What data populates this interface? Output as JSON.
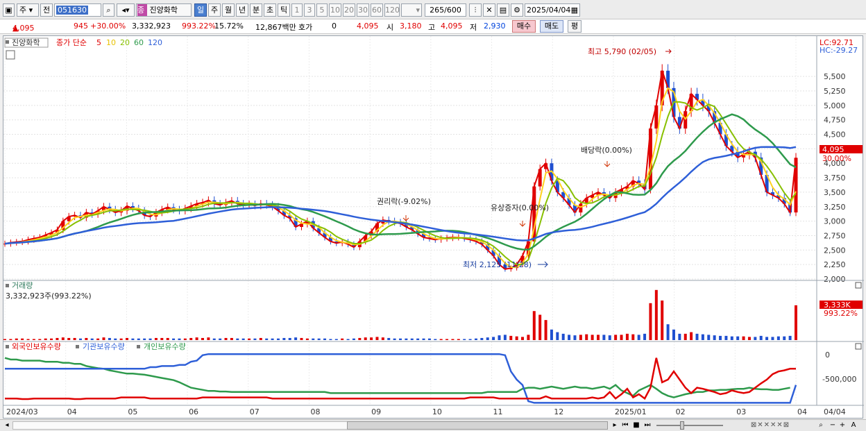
{
  "toolbar": {
    "stock_type": "주",
    "prev_label": "전",
    "code": "051630",
    "stock_name": "진양화학",
    "badge": "종",
    "periods": [
      "일",
      "주",
      "월",
      "년",
      "분",
      "초",
      "틱"
    ],
    "active_period": "일",
    "intervals": [
      "1",
      "3",
      "5",
      "10",
      "20",
      "30",
      "60",
      "120"
    ],
    "count": "265",
    "count_total": "/600",
    "date": "2025/04/04"
  },
  "quote": {
    "price": "4,095",
    "change": "945",
    "change_pct": "+30.00%",
    "volume": "3,332,923",
    "volume_ratio": "993.22%",
    "turnover_pct": "15.72%",
    "trade_value": "12,867백만",
    "hoga_label": "호가",
    "hoga_value": "0",
    "hoga_price": "4,095",
    "open_label": "시",
    "open": "3,180",
    "high_label": "고",
    "high": "4,095",
    "low_label": "저",
    "low": "2,930",
    "buy_label": "매수",
    "sell_label": "매도",
    "avg_label": "평"
  },
  "price_panel": {
    "name_tag": "진양화학",
    "ma_label": "종가 단순",
    "ma_periods": [
      "5",
      "10",
      "20",
      "60",
      "120"
    ],
    "ma_colors": [
      "#e00000",
      "#ffd21f",
      "#88c000",
      "#2e9a4c",
      "#2e5fd8"
    ],
    "lc": "LC:92.71",
    "hc": "HC:-29.27",
    "last_price": "4,095",
    "last_pct": "30.00%",
    "annotations": {
      "high": "최고 5,790 (02/05)",
      "low": "최저 2,125 (11/28)",
      "rights": "권리락(-9.02%)",
      "capital": "유상증자(0.00%)",
      "dividend": "배당락(0.00%)"
    },
    "y_ticks": [
      "5,500",
      "5,250",
      "5,000",
      "4,750",
      "4,500",
      "4,250",
      "4,000",
      "3,750",
      "3,500",
      "3,250",
      "3,000",
      "2,750",
      "2,500",
      "2,250",
      "2,000"
    ]
  },
  "volume_panel": {
    "title": "거래량",
    "subtitle": "3,332,923주(993.22%)",
    "last_value": "3,333K",
    "last_pct": "993.22%"
  },
  "holdings_panel": {
    "series": [
      "외국인보유수량",
      "기관보유수량",
      "개인보유수량"
    ],
    "series_colors": [
      "#e00000",
      "#2e5fd8",
      "#2e9a4c"
    ],
    "y_ticks": [
      "0",
      "-500,000"
    ]
  },
  "x_axis": {
    "labels": [
      "2024/03",
      "04",
      "05",
      "06",
      "07",
      "08",
      "09",
      "10",
      "11",
      "12",
      "2025/01",
      "02",
      "03",
      "04"
    ],
    "current": "04/04"
  },
  "chart_data": {
    "type": "candlestick",
    "ylim": [
      2000,
      5790
    ],
    "close": [
      2610,
      2630,
      2640,
      2650,
      2680,
      2700,
      2720,
      2760,
      2800,
      2850,
      3000,
      3080,
      3100,
      3060,
      3150,
      3120,
      3180,
      3250,
      3200,
      3150,
      3180,
      3260,
      3220,
      3180,
      3100,
      3080,
      3150,
      3200,
      3240,
      3200,
      3180,
      3220,
      3260,
      3300,
      3320,
      3360,
      3300,
      3280,
      3320,
      3350,
      3300,
      3280,
      3290,
      3270,
      3300,
      3280,
      3250,
      3180,
      3100,
      3050,
      2900,
      2950,
      3000,
      2880,
      2800,
      2720,
      2650,
      2620,
      2640,
      2600,
      2550,
      2650,
      2750,
      2820,
      2960,
      3020,
      3000,
      2980,
      2960,
      2900,
      2850,
      2780,
      2720,
      2700,
      2680,
      2700,
      2710,
      2720,
      2720,
      2700,
      2680,
      2650,
      2600,
      2500,
      2400,
      2250,
      2170,
      2190,
      2250,
      2400,
      2650,
      3600,
      3900,
      4000,
      3700,
      3500,
      3400,
      3280,
      3150,
      3300,
      3400,
      3450,
      3500,
      3450,
      3400,
      3500,
      3550,
      3600,
      3700,
      3650,
      3550,
      4600,
      5000,
      5600,
      5300,
      4800,
      4600,
      4900,
      5200,
      5100,
      5000,
      4900,
      4700,
      4500,
      4300,
      4200,
      4100,
      4150,
      4200,
      4100,
      3800,
      3500,
      3450,
      3400,
      3300,
      3150,
      4095
    ],
    "volume": [
      0.02,
      0.02,
      0.03,
      0.03,
      0.02,
      0.02,
      0.02,
      0.03,
      0.03,
      0.04,
      0.05,
      0.04,
      0.04,
      0.03,
      0.04,
      0.03,
      0.03,
      0.05,
      0.04,
      0.03,
      0.03,
      0.04,
      0.03,
      0.03,
      0.03,
      0.03,
      0.04,
      0.04,
      0.04,
      0.03,
      0.03,
      0.03,
      0.04,
      0.05,
      0.04,
      0.05,
      0.03,
      0.03,
      0.04,
      0.04,
      0.03,
      0.03,
      0.03,
      0.03,
      0.04,
      0.03,
      0.03,
      0.03,
      0.04,
      0.04,
      0.05,
      0.04,
      0.03,
      0.03,
      0.03,
      0.03,
      0.02,
      0.02,
      0.03,
      0.02,
      0.03,
      0.04,
      0.05,
      0.05,
      0.06,
      0.05,
      0.04,
      0.03,
      0.03,
      0.03,
      0.03,
      0.03,
      0.03,
      0.03,
      0.02,
      0.02,
      0.02,
      0.02,
      0.02,
      0.02,
      0.02,
      0.03,
      0.04,
      0.05,
      0.06,
      0.09,
      0.1,
      0.08,
      0.07,
      0.06,
      0.1,
      0.55,
      0.48,
      0.38,
      0.2,
      0.15,
      0.12,
      0.1,
      0.09,
      0.1,
      0.11,
      0.1,
      0.1,
      0.1,
      0.09,
      0.1,
      0.1,
      0.12,
      0.11,
      0.1,
      0.12,
      0.7,
      0.95,
      0.75,
      0.3,
      0.2,
      0.12,
      0.12,
      0.15,
      0.12,
      0.11,
      0.1,
      0.09,
      0.08,
      0.08,
      0.07,
      0.07,
      0.07,
      0.06,
      0.06,
      0.08,
      0.06,
      0.06,
      0.07,
      0.07,
      0.08,
      0.66
    ],
    "foreign": [
      0.1,
      0.1,
      0.1,
      0.09,
      0.09,
      0.1,
      0.1,
      0.1,
      0.1,
      0.1,
      0.1,
      0.1,
      0.09,
      0.09,
      0.1,
      0.1,
      0.1,
      0.1,
      0.1,
      0.1,
      0.12,
      0.12,
      0.12,
      0.12,
      0.12,
      0.1,
      0.1,
      0.1,
      0.1,
      0.1,
      0.1,
      0.1,
      0.1,
      0.1,
      0.12,
      0.12,
      0.12,
      0.12,
      0.12,
      0.12,
      0.12,
      0.12,
      0.12,
      0.12,
      0.12,
      0.12,
      0.1,
      0.1,
      0.1,
      0.1,
      0.1,
      0.1,
      0.1,
      0.1,
      0.1,
      0.1,
      0.1,
      0.1,
      0.1,
      0.1,
      0.1,
      0.1,
      0.1,
      0.1,
      0.1,
      0.1,
      0.1,
      0.1,
      0.1,
      0.1,
      0.1,
      0.1,
      0.1,
      0.1,
      0.1,
      0.1,
      0.1,
      0.1,
      0.1,
      0.1,
      0.12,
      0.12,
      0.12,
      0.12,
      0.12,
      0.1,
      0.1,
      0.1,
      0.1,
      0.1,
      0.1,
      0.1,
      0.1,
      0.14,
      0.1,
      0.1,
      0.1,
      0.1,
      0.1,
      0.1,
      0.1,
      0.12,
      0.1,
      0.12,
      0.22,
      0.1,
      0.18,
      0.28,
      0.12,
      0.18,
      0.1,
      0.3,
      0.85,
      0.4,
      0.45,
      0.6,
      0.45,
      0.3,
      0.2,
      0.3,
      0.28,
      0.25,
      0.22,
      0.18,
      0.2,
      0.25,
      0.22,
      0.2,
      0.22,
      0.3,
      0.38,
      0.45,
      0.55,
      0.6,
      0.62,
      0.65,
      0.65
    ],
    "institution": [
      0.65,
      0.65,
      0.65,
      0.65,
      0.65,
      0.65,
      0.65,
      0.65,
      0.65,
      0.65,
      0.65,
      0.65,
      0.65,
      0.65,
      0.65,
      0.65,
      0.65,
      0.65,
      0.65,
      0.65,
      0.65,
      0.65,
      0.65,
      0.65,
      0.65,
      0.68,
      0.68,
      0.7,
      0.7,
      0.7,
      0.72,
      0.72,
      0.78,
      0.8,
      0.9,
      0.92,
      0.92,
      0.92,
      0.92,
      0.92,
      0.92,
      0.92,
      0.92,
      0.92,
      0.92,
      0.92,
      0.92,
      0.92,
      0.92,
      0.92,
      0.92,
      0.92,
      0.92,
      0.92,
      0.92,
      0.92,
      0.92,
      0.92,
      0.92,
      0.92,
      0.92,
      0.92,
      0.92,
      0.92,
      0.92,
      0.92,
      0.92,
      0.92,
      0.92,
      0.92,
      0.92,
      0.92,
      0.92,
      0.92,
      0.92,
      0.92,
      0.92,
      0.92,
      0.92,
      0.92,
      0.92,
      0.92,
      0.92,
      0.92,
      0.92,
      0.92,
      0.9,
      0.6,
      0.45,
      0.35,
      0.05,
      0.02,
      0.02,
      0.02,
      0.02,
      0.02,
      0.02,
      0.02,
      0.02,
      0.02,
      0.02,
      0.02,
      0.02,
      0.02,
      0.02,
      0.02,
      0.02,
      0.02,
      0.02,
      0.02,
      0.02,
      0.02,
      0.02,
      0.02,
      0.02,
      0.02,
      0.02,
      0.02,
      0.02,
      0.02,
      0.02,
      0.02,
      0.02,
      0.02,
      0.02,
      0.02,
      0.02,
      0.02,
      0.02,
      0.02,
      0.02,
      0.02,
      0.02,
      0.02,
      0.02,
      0.02,
      0.35
    ],
    "individual": [
      0.85,
      0.82,
      0.82,
      0.8,
      0.8,
      0.8,
      0.8,
      0.78,
      0.78,
      0.78,
      0.76,
      0.76,
      0.74,
      0.74,
      0.7,
      0.68,
      0.66,
      0.65,
      0.62,
      0.6,
      0.58,
      0.56,
      0.56,
      0.55,
      0.54,
      0.52,
      0.5,
      0.48,
      0.46,
      0.44,
      0.4,
      0.35,
      0.3,
      0.28,
      0.26,
      0.24,
      0.24,
      0.23,
      0.23,
      0.22,
      0.22,
      0.22,
      0.22,
      0.22,
      0.22,
      0.22,
      0.22,
      0.22,
      0.22,
      0.22,
      0.22,
      0.22,
      0.22,
      0.22,
      0.22,
      0.22,
      0.2,
      0.2,
      0.2,
      0.2,
      0.2,
      0.2,
      0.2,
      0.2,
      0.2,
      0.2,
      0.2,
      0.2,
      0.2,
      0.2,
      0.2,
      0.2,
      0.2,
      0.2,
      0.2,
      0.2,
      0.2,
      0.2,
      0.2,
      0.2,
      0.2,
      0.2,
      0.2,
      0.22,
      0.22,
      0.22,
      0.22,
      0.22,
      0.22,
      0.28,
      0.3,
      0.3,
      0.28,
      0.3,
      0.32,
      0.3,
      0.28,
      0.3,
      0.32,
      0.3,
      0.3,
      0.28,
      0.3,
      0.32,
      0.28,
      0.35,
      0.25,
      0.2,
      0.15,
      0.25,
      0.3,
      0.35,
      0.28,
      0.2,
      0.15,
      0.12,
      0.15,
      0.18,
      0.2,
      0.22,
      0.22,
      0.25,
      0.25,
      0.26,
      0.26,
      0.27,
      0.28,
      0.28,
      0.3,
      0.28,
      0.27,
      0.27,
      0.26,
      0.26,
      0.28,
      0.3
    ]
  }
}
